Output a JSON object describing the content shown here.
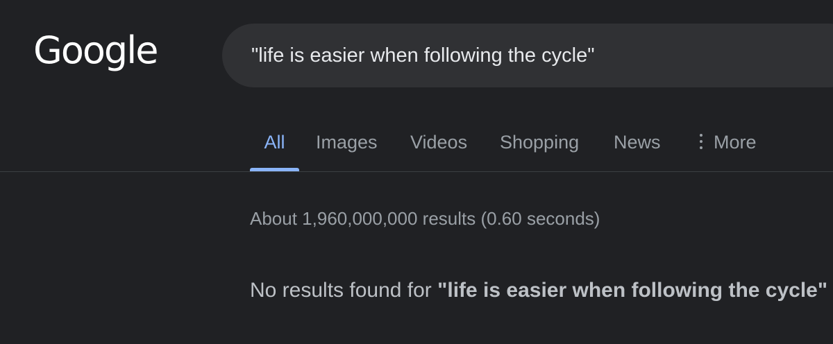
{
  "logo": {
    "text": "Google"
  },
  "search": {
    "query": "\"life is easier when following the cycle\""
  },
  "tabs": [
    {
      "label": "All",
      "active": true
    },
    {
      "label": "Images"
    },
    {
      "label": "Videos"
    },
    {
      "label": "Shopping"
    },
    {
      "label": "News"
    },
    {
      "label": "More",
      "icon": "more-vert-icon"
    }
  ],
  "results": {
    "stats": "About 1,960,000,000 results (0.60 seconds)",
    "no_results_prefix": "No results found for ",
    "no_results_query": "\"life is easier when following the cycle\""
  },
  "colors": {
    "background": "#202124",
    "search_box": "#303134",
    "accent": "#8ab4f8",
    "muted_text": "#9aa0a6"
  }
}
